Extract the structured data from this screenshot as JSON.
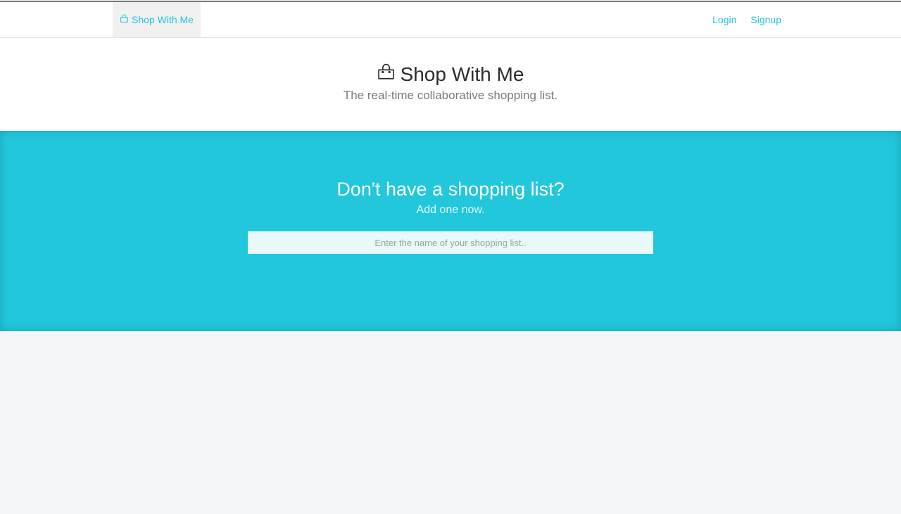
{
  "navbar": {
    "brand_label": "Shop With Me",
    "brand_icon": "shopping-bag-icon",
    "login_label": "Login",
    "signup_label": "Signup"
  },
  "hero": {
    "title": "Shop With Me",
    "title_icon": "shopping-bag-icon",
    "subtitle": "The real-time collaborative shopping list."
  },
  "cta": {
    "title": "Don't have a shopping list?",
    "subtitle": "Add one now.",
    "input_placeholder": "Enter the name of your shopping list..",
    "input_value": ""
  },
  "colors": {
    "accent": "#23c6da",
    "cta_background": "#22c7dc",
    "page_background": "#f4f6f9"
  }
}
